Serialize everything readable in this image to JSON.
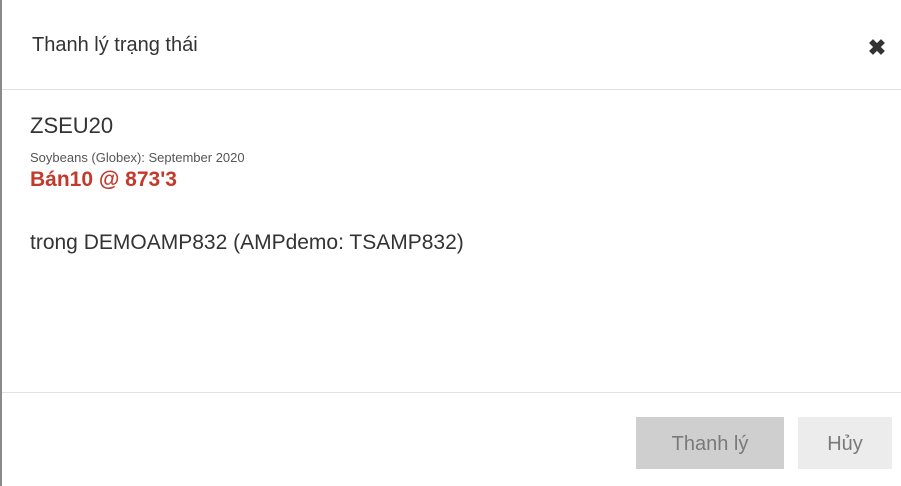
{
  "dialog": {
    "title": "Thanh lý trạng thái",
    "close_icon": "close-icon"
  },
  "position": {
    "symbol": "ZSEU20",
    "description": "Soybeans (Globex): September 2020",
    "order": "Bán10 @ 873'3",
    "account": "trong DEMOAMP832 (AMPdemo: TSAMP832)"
  },
  "footer": {
    "confirm_label": "Thanh lý",
    "cancel_label": "Hủy"
  },
  "colors": {
    "sell_text": "#c23a2c",
    "confirm_button_bg": "#cfcfcf",
    "cancel_button_bg": "#ececec"
  }
}
